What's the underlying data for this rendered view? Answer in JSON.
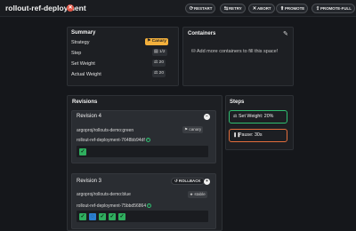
{
  "header": {
    "title": "rollout-ref-deployment",
    "buttons": {
      "restart": "RESTART",
      "retry": "RETRY",
      "abort": "ABORT",
      "promote": "PROMOTE",
      "promote_full": "PROMOTE-FULL"
    }
  },
  "summary": {
    "heading": "Summary",
    "strategy_label": "Strategy",
    "strategy_value": "Canary",
    "step_label": "Step",
    "step_value": "1/2",
    "set_weight_label": "Set Weight",
    "set_weight_value": "20",
    "actual_weight_label": "Actual Weight",
    "actual_weight_value": "20"
  },
  "containers": {
    "heading": "Containers",
    "empty_text": "Add more containers to fill this space!"
  },
  "revisions": {
    "heading": "Revisions",
    "items": [
      {
        "title": "Revision 4",
        "image": "argoproj/rollouts-demo:green",
        "tag": "canary",
        "replicaset": "rollout-ref-deployment-7648bb94df"
      },
      {
        "title": "Revision 3",
        "image": "argoproj/rollouts-demo:blue",
        "tag": "stable",
        "replicaset": "rollout-ref-deployment-75bbd56864",
        "rollback_label": "ROLLBACK"
      }
    ]
  },
  "steps": {
    "heading": "Steps",
    "items": [
      {
        "label": "Set Weight: 20%",
        "status": "complete"
      },
      {
        "label": "Pause: 30s",
        "status": "current"
      }
    ]
  },
  "colors": {
    "success": "#2fbf71",
    "canary": "#f3b03c",
    "pause": "#e36e3c",
    "error": "#e05545",
    "syncing": "#2b7fcf"
  }
}
